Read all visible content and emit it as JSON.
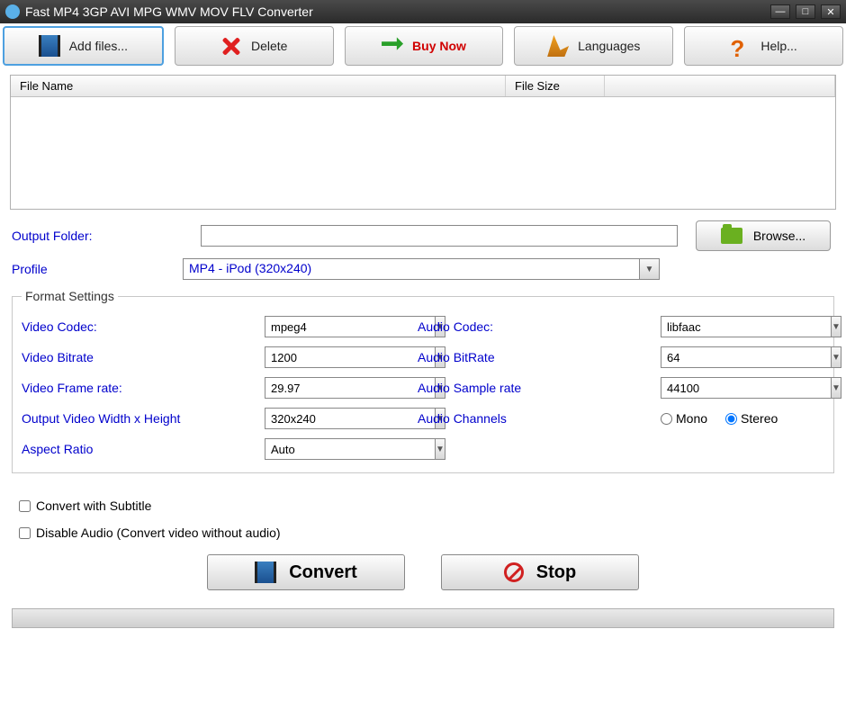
{
  "window": {
    "title": "Fast MP4 3GP AVI MPG WMV MOV FLV Converter"
  },
  "toolbar": {
    "addfiles": "Add files...",
    "delete": "Delete",
    "buynow": "Buy Now",
    "languages": "Languages",
    "help": "Help..."
  },
  "filelist": {
    "col_filename": "File Name",
    "col_filesize": "File Size"
  },
  "output": {
    "folder_label": "Output Folder:",
    "folder_value": "",
    "browse": "Browse...",
    "profile_label": "Profile",
    "profile_value": "MP4 - iPod (320x240)"
  },
  "format": {
    "legend": "Format Settings",
    "video_codec_label": "Video Codec:",
    "video_codec": "mpeg4",
    "video_bitrate_label": "Video Bitrate",
    "video_bitrate": "1200",
    "video_framerate_label": "Video Frame rate:",
    "video_framerate": "29.97",
    "video_size_label": "Output Video Width x Height",
    "video_size": "320x240",
    "aspect_label": "Aspect Ratio",
    "aspect": "Auto",
    "audio_codec_label": "Audio Codec:",
    "audio_codec": "libfaac",
    "audio_bitrate_label": "Audio BitRate",
    "audio_bitrate": "64",
    "audio_sample_label": "Audio Sample rate",
    "audio_sample": "44100",
    "audio_channels_label": "Audio Channels",
    "mono": "Mono",
    "stereo": "Stereo"
  },
  "options": {
    "subtitle": "Convert with Subtitle",
    "disable_audio": "Disable Audio (Convert video without audio)"
  },
  "actions": {
    "convert": "Convert",
    "stop": "Stop"
  }
}
